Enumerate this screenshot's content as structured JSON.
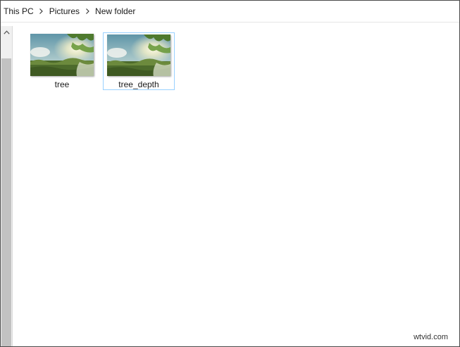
{
  "breadcrumb": {
    "items": [
      "This PC",
      "Pictures",
      "New folder"
    ],
    "separator_icon": "chevron-right-icon"
  },
  "scrollbar": {
    "up_icon": "chevron-up-icon"
  },
  "files": [
    {
      "name": "tree",
      "selected": false,
      "thumbnail": "landscape-photo"
    },
    {
      "name": "tree_depth",
      "selected": true,
      "thumbnail": "landscape-photo"
    }
  ],
  "watermark": "wtvid.com",
  "colors": {
    "selection_border": "#99d1ff",
    "scrollbar_track": "#f0f0f0",
    "scrollbar_thumb": "#c2c2c2"
  }
}
